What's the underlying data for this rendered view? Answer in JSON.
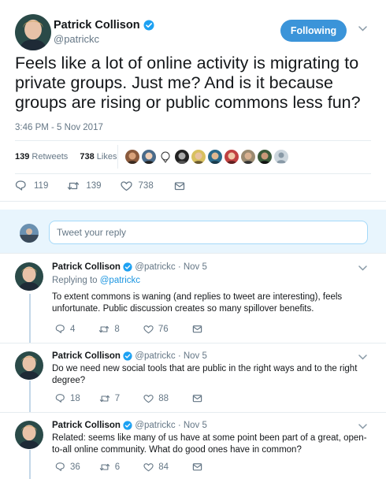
{
  "tweet": {
    "author_name": "Patrick Collison",
    "handle": "@patrickc",
    "follow_label": "Following",
    "text": "Feels like a lot of online activity is migrating to private groups. Just me? And is it because groups are rising or public commons less fun?",
    "timestamp": "3:46 PM - 5 Nov 2017",
    "retweets_count": "139",
    "retweets_label": "Retweets",
    "likes_count": "738",
    "likes_label": "Likes",
    "actions": {
      "replies": "119",
      "retweets": "139",
      "likes": "738"
    }
  },
  "reply_box": {
    "placeholder": "Tweet your reply"
  },
  "replies": [
    {
      "author_name": "Patrick Collison",
      "handle_and_date": "@patrickc · Nov 5",
      "replying_prefix": "Replying to",
      "replying_to": "@patrickc",
      "text": "To extent commons is waning (and replies to tweet are interesting), feels unfortunate. Public discussion creates so many spillover benefits.",
      "replies": "4",
      "retweets": "8",
      "likes": "76"
    },
    {
      "author_name": "Patrick Collison",
      "handle_and_date": "@patrickc · Nov 5",
      "text": "Do we need new social tools that are public in the right ways and to the right degree?",
      "replies": "18",
      "retweets": "7",
      "likes": "88"
    },
    {
      "author_name": "Patrick Collison",
      "handle_and_date": "@patrickc · Nov 5",
      "text": "Related: seems like many of us have at some point been part of a great, open-to-all online community. What do good ones have in common?",
      "replies": "36",
      "retweets": "6",
      "likes": "84"
    }
  ],
  "colors": {
    "accent": "#1da1f2",
    "follow_button": "#3b94d9",
    "muted": "#657786",
    "reply_bar": "#e8f5fd"
  },
  "icons": [
    "verified-icon",
    "chevron-down-icon",
    "reply-icon",
    "retweet-icon",
    "like-icon",
    "message-icon"
  ]
}
